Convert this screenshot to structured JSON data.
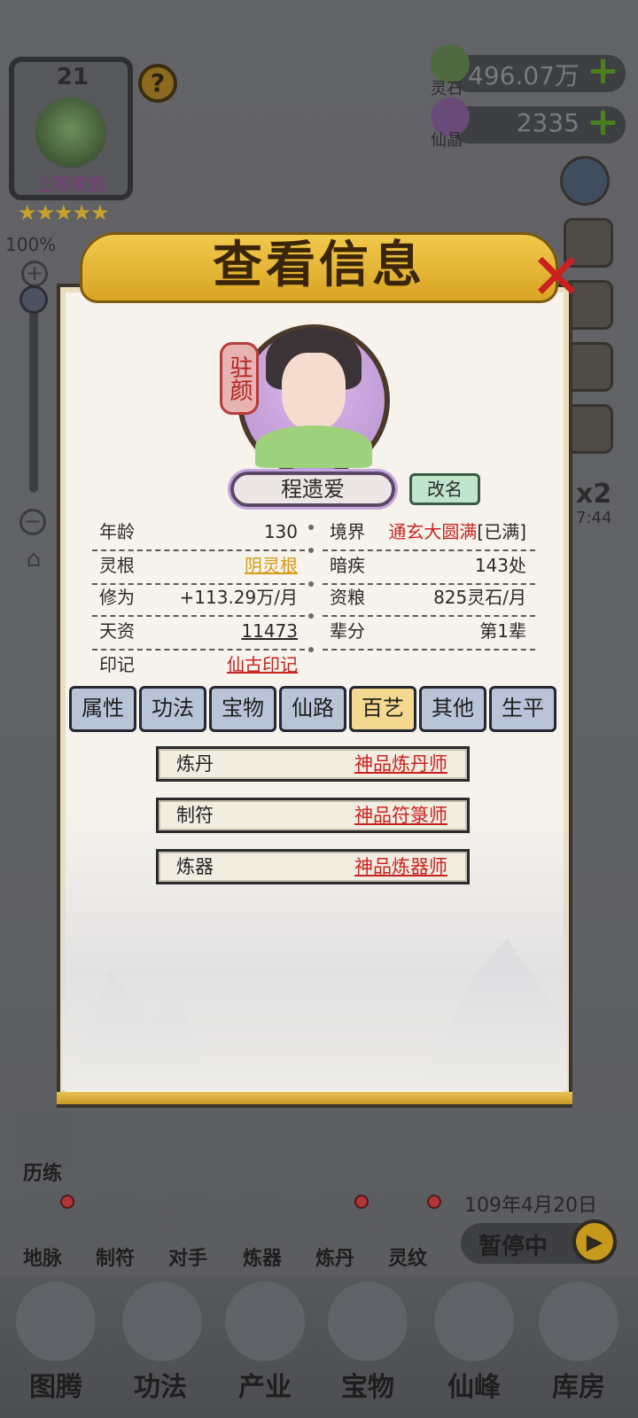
{
  "clan": {
    "level": "21",
    "label": "上等家族",
    "stars": "★★★★★",
    "help": "?"
  },
  "zoom": {
    "percent": "100%",
    "plus": "+",
    "minus": "−",
    "level": 1.0
  },
  "currency": {
    "spirit_stone": {
      "label": "灵石",
      "value": "496.07万",
      "add": "+"
    },
    "immortal_crystal": {
      "label": "仙晶",
      "value": "2335",
      "add": "+"
    }
  },
  "side_buttons": {
    "speed_label": "x2",
    "speed_timer": "7:44"
  },
  "panel": {
    "title": "查看信息",
    "seal": "驻颜",
    "name": "程遗爱",
    "rename_label": "改名",
    "info_left": [
      {
        "key": "年龄",
        "value": "130"
      },
      {
        "key": "灵根",
        "value": "阴灵根"
      },
      {
        "key": "修为",
        "value": "+113.29万/月"
      },
      {
        "key": "天资",
        "value": "11473"
      },
      {
        "key": "印记",
        "value": "仙古印记"
      }
    ],
    "info_right": [
      {
        "key": "境界",
        "value": "通玄大圆满",
        "suffix": "[已满]"
      },
      {
        "key": "暗疾",
        "value": "143处"
      },
      {
        "key": "资粮",
        "value": "825灵石/月"
      },
      {
        "key": "辈分",
        "value": "第1辈"
      }
    ],
    "tabs": [
      "属性",
      "功法",
      "宝物",
      "仙路",
      "百艺",
      "其他",
      "生平"
    ],
    "active_tab": "百艺",
    "skills": [
      {
        "name": "炼丹",
        "rank": "神品炼丹师"
      },
      {
        "name": "制符",
        "rank": "神品符箓师"
      },
      {
        "name": "炼器",
        "rank": "神品炼器师"
      }
    ]
  },
  "hud": {
    "training_label": "历练",
    "actions": [
      "地脉",
      "制符",
      "对手",
      "炼器",
      "炼丹",
      "灵纹"
    ],
    "date": "109年4月20日",
    "pause_label": "暂停中",
    "play": "▶"
  },
  "bottom_nav": [
    "图腾",
    "功法",
    "产业",
    "宝物",
    "仙峰",
    "库房"
  ],
  "colors": {
    "accent_red": "#c8221f",
    "gold": "#d49a16",
    "tab_active": "#f6d991",
    "tab_idle": "#b9c4d8"
  }
}
